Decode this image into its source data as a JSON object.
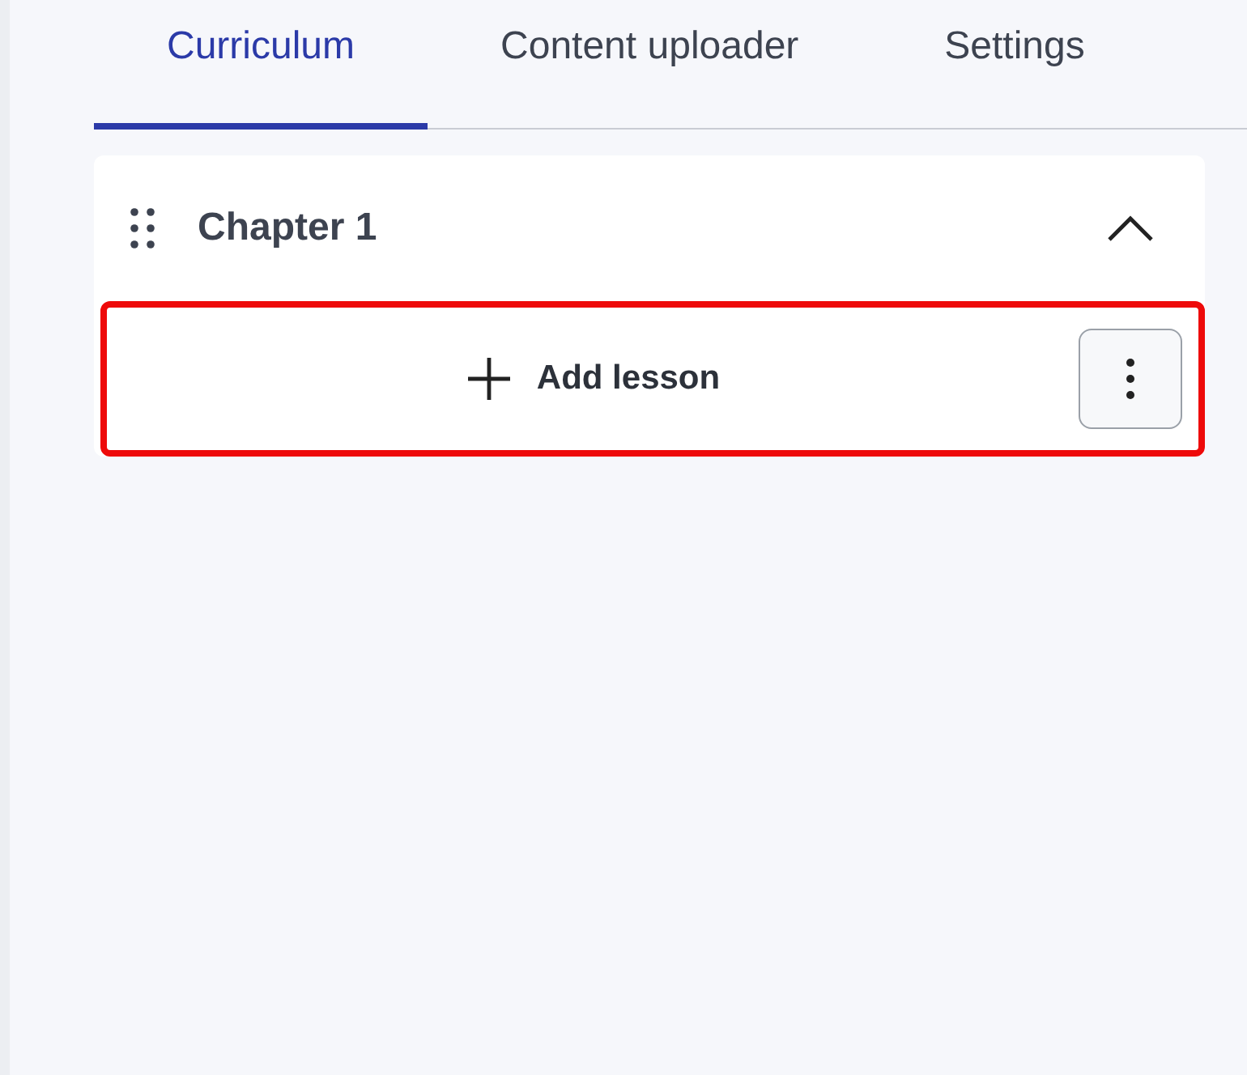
{
  "tabs": [
    {
      "label": "Curriculum",
      "selected": true
    },
    {
      "label": "Content uploader",
      "selected": false
    },
    {
      "label": "Settings",
      "selected": false
    }
  ],
  "chapter": {
    "title": "Chapter 1",
    "expanded": true,
    "add_lesson": {
      "label": "Add lesson",
      "highlighted": true
    }
  }
}
